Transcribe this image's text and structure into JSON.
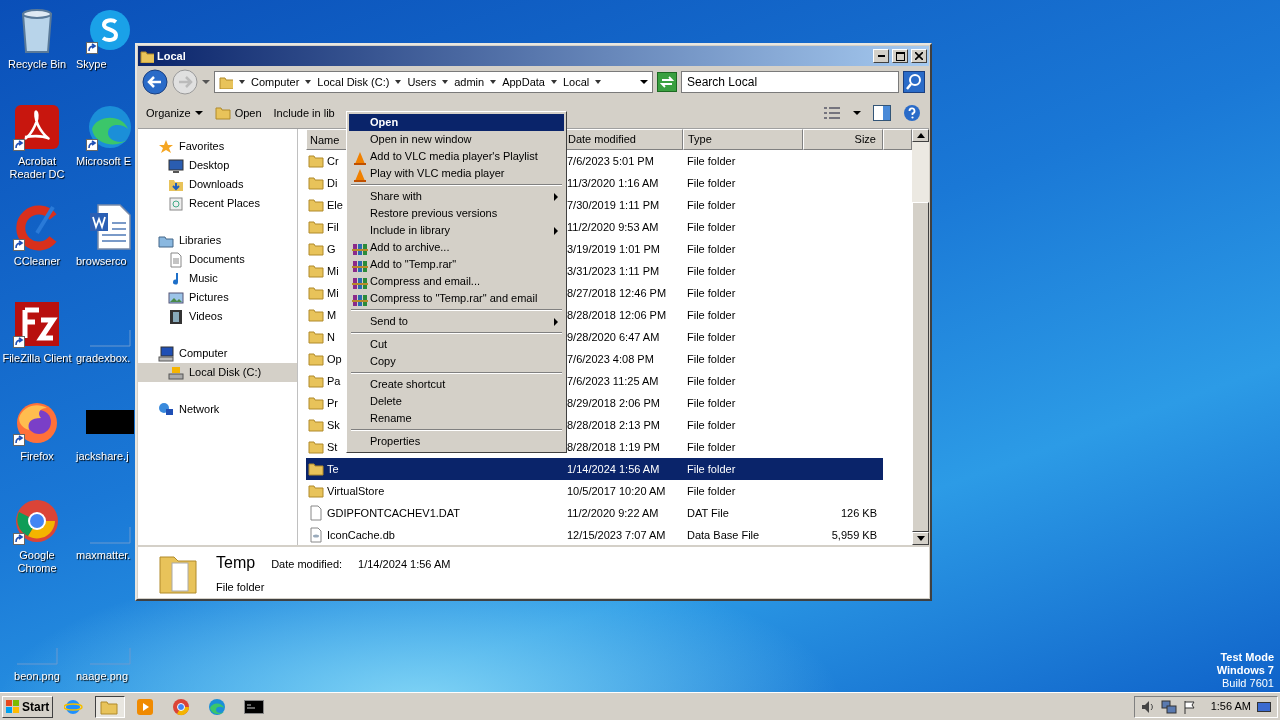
{
  "desktop_icons": [
    {
      "label": "Recycle Bin",
      "shortcut": false
    },
    {
      "label": "Skype",
      "shortcut": true
    },
    {
      "label": "Acrobat Reader DC",
      "shortcut": true
    },
    {
      "label": "Microsoft E",
      "shortcut": true
    },
    {
      "label": "CCleaner",
      "shortcut": true
    },
    {
      "label": "browserco",
      "shortcut": false
    },
    {
      "label": "FileZilla Client",
      "shortcut": true
    },
    {
      "label": "gradexbox.",
      "shortcut": false
    },
    {
      "label": "Firefox",
      "shortcut": true
    },
    {
      "label": "jackshare.j",
      "shortcut": false
    },
    {
      "label": "Google Chrome",
      "shortcut": true
    },
    {
      "label": "maxmatter.",
      "shortcut": false
    },
    {
      "label": "beon.png",
      "shortcut": false
    },
    {
      "label": "naage.png",
      "shortcut": false
    }
  ],
  "window": {
    "title": "Local",
    "breadcrumb": [
      "Computer",
      "Local Disk (C:)",
      "Users",
      "admin",
      "AppData",
      "Local"
    ],
    "search": {
      "placeholder": "Search Local"
    },
    "toolbar": [
      "Organize",
      "Open",
      "Include in lib"
    ],
    "nav": [
      {
        "label": "Favorites",
        "selected": false,
        "children": [
          {
            "label": "Desktop",
            "selected": false
          },
          {
            "label": "Downloads",
            "selected": false
          },
          {
            "label": "Recent Places",
            "selected": false
          }
        ]
      },
      {
        "label": "Libraries",
        "selected": false,
        "children": [
          {
            "label": "Documents",
            "selected": false
          },
          {
            "label": "Music",
            "selected": false
          },
          {
            "label": "Pictures",
            "selected": false
          },
          {
            "label": "Videos",
            "selected": false
          }
        ]
      },
      {
        "label": "Computer",
        "selected": false,
        "children": [
          {
            "label": "Local Disk (C:)",
            "selected": true
          }
        ]
      },
      {
        "label": "Network",
        "selected": false
      }
    ],
    "columns": [
      "Name",
      "Date modified",
      "Type",
      "Size"
    ],
    "rows": [
      {
        "name": "Cr",
        "date": "7/6/2023 5:01 PM",
        "type": "File folder",
        "kind": "folder",
        "selected": false
      },
      {
        "name": "Di",
        "date": "11/3/2020 1:16 AM",
        "type": "File folder",
        "kind": "folder",
        "selected": false
      },
      {
        "name": "Ele",
        "date": "7/30/2019 1:11 PM",
        "type": "File folder",
        "kind": "folder",
        "selected": false
      },
      {
        "name": "Fil",
        "date": "11/2/2020 9:53 AM",
        "type": "File folder",
        "kind": "folder",
        "selected": false
      },
      {
        "name": "G",
        "date": "3/19/2019 1:01 PM",
        "type": "File folder",
        "kind": "folder",
        "selected": false
      },
      {
        "name": "Mi",
        "date": "3/31/2023 1:11 PM",
        "type": "File folder",
        "kind": "folder",
        "selected": false
      },
      {
        "name": "Mi",
        "date": "8/27/2018 12:46 PM",
        "type": "File folder",
        "kind": "folder",
        "selected": false
      },
      {
        "name": "M",
        "date": "8/28/2018 12:06 PM",
        "type": "File folder",
        "kind": "folder",
        "selected": false
      },
      {
        "name": "N",
        "date": "9/28/2020 6:47 AM",
        "type": "File folder",
        "kind": "folder",
        "selected": false
      },
      {
        "name": "Op",
        "date": "7/6/2023 4:08 PM",
        "type": "File folder",
        "kind": "folder",
        "selected": false
      },
      {
        "name": "Pa",
        "date": "7/6/2023 11:25 AM",
        "type": "File folder",
        "kind": "folder",
        "selected": false
      },
      {
        "name": "Pr",
        "date": "8/29/2018 2:06 PM",
        "type": "File folder",
        "kind": "folder",
        "selected": false
      },
      {
        "name": "Sk",
        "date": "8/28/2018 2:13 PM",
        "type": "File folder",
        "kind": "folder",
        "selected": false
      },
      {
        "name": "St",
        "date": "8/28/2018 1:19 PM",
        "type": "File folder",
        "kind": "folder",
        "selected": false
      },
      {
        "name": "Te",
        "date": "1/14/2024 1:56 AM",
        "type": "File folder",
        "kind": "folder",
        "selected": true
      },
      {
        "name": "VirtualStore",
        "date": "10/5/2017 10:20 AM",
        "type": "File folder",
        "kind": "folder",
        "selected": false
      },
      {
        "name": "GDIPFONTCACHEV1.DAT",
        "date": "11/2/2020 9:22 AM",
        "type": "DAT File",
        "size": "126 KB",
        "kind": "file",
        "selected": false
      },
      {
        "name": "IconCache.db",
        "date": "12/15/2023 7:07 AM",
        "type": "Data Base File",
        "size": "5,959 KB",
        "kind": "database",
        "selected": false
      }
    ],
    "details": {
      "name": "Temp",
      "date_label": "Date modified:",
      "date": "1/14/2024 1:56 AM",
      "type": "File folder"
    }
  },
  "context_menu": [
    {
      "kind": "item",
      "label": "Open",
      "default": true,
      "selected": true
    },
    {
      "kind": "item",
      "label": "Open in new window",
      "default": false,
      "selected": false
    },
    {
      "kind": "vlc",
      "label": "Add to VLC media player's Playlist",
      "default": false,
      "selected": false
    },
    {
      "kind": "vlc",
      "label": "Play with VLC media player",
      "default": false,
      "selected": false
    },
    {
      "kind": "separator"
    },
    {
      "kind": "item",
      "label": "Share with",
      "submenu": true,
      "default": false,
      "selected": false
    },
    {
      "kind": "item",
      "label": "Restore previous versions",
      "default": false,
      "selected": false
    },
    {
      "kind": "item",
      "label": "Include in library",
      "submenu": true,
      "default": false,
      "selected": false
    },
    {
      "kind": "archive",
      "label": "Add to archive...",
      "default": false,
      "selected": false
    },
    {
      "kind": "archive",
      "label": "Add to \"Temp.rar\"",
      "default": false,
      "selected": false
    },
    {
      "kind": "archive",
      "label": "Compress and email...",
      "default": false,
      "selected": false
    },
    {
      "kind": "archive",
      "label": "Compress to \"Temp.rar\" and email",
      "default": false,
      "selected": false
    },
    {
      "kind": "separator"
    },
    {
      "kind": "item",
      "label": "Send to",
      "submenu": true,
      "default": false,
      "selected": false
    },
    {
      "kind": "separator"
    },
    {
      "kind": "item",
      "label": "Cut",
      "default": false,
      "selected": false
    },
    {
      "kind": "item",
      "label": "Copy",
      "default": false,
      "selected": false
    },
    {
      "kind": "separator"
    },
    {
      "kind": "item",
      "label": "Create shortcut",
      "default": false,
      "selected": false
    },
    {
      "kind": "item",
      "label": "Delete",
      "default": false,
      "selected": false
    },
    {
      "kind": "item",
      "label": "Rename",
      "default": false,
      "selected": false
    },
    {
      "kind": "separator"
    },
    {
      "kind": "item",
      "label": "Properties",
      "default": false,
      "selected": false
    }
  ],
  "os_info": [
    "Test Mode",
    "Windows 7",
    "Build 7601"
  ],
  "taskbar": {
    "start": "Start",
    "apps": [
      {
        "selected": false
      },
      {
        "selected": true
      },
      {
        "selected": false
      },
      {
        "selected": false
      },
      {
        "selected": false
      },
      {
        "selected": false
      }
    ],
    "clock": "1:56 AM"
  }
}
